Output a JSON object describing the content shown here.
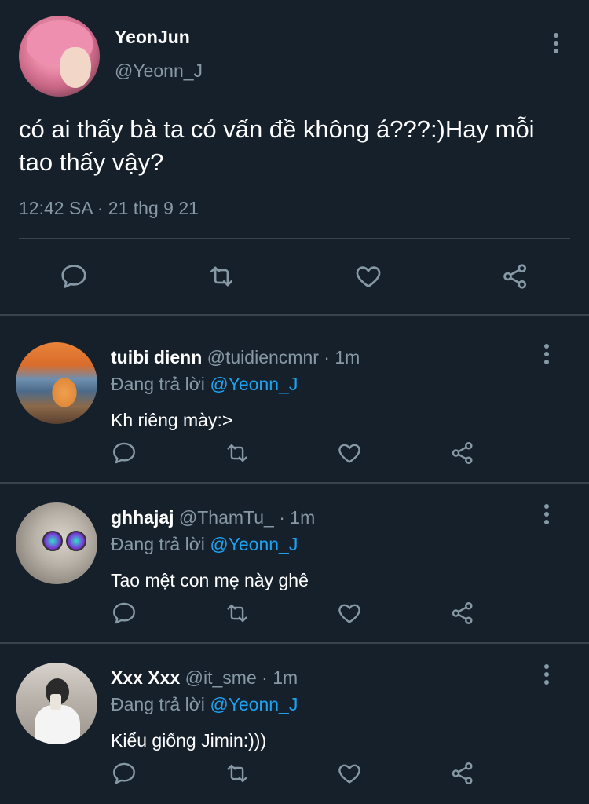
{
  "main_tweet": {
    "name": "YeonJun",
    "handle": "@Yeonn_J",
    "text": "có ai thấy bà ta có vấn đề không á???:)Hay mỗi tao thấy vậy?",
    "timestamp": "12:42 SA · 21 thg 9 21"
  },
  "icons": {
    "reply": "comment-icon",
    "retweet": "retweet-icon",
    "like": "heart-icon",
    "share": "share-icon",
    "more": "more-vertical-icon"
  },
  "colors": {
    "background": "#15202b",
    "secondary_text": "#8899a6",
    "mention": "#1da1f2",
    "divider": "#38444d"
  },
  "replies": [
    {
      "name": "tuibi dienn",
      "handle": "@tuidiencmnr",
      "dot": "·",
      "time": "1m",
      "replying_prefix": "Đang trả lời",
      "replying_to": "@Yeonn_J",
      "text": "Kh riêng mày:>"
    },
    {
      "name": "ghhajaj",
      "handle": "@ThamTu_",
      "dot": "·",
      "time": "1m",
      "replying_prefix": "Đang trả lời",
      "replying_to": "@Yeonn_J",
      "text": "Tao mệt con mẹ này ghê"
    },
    {
      "name": "Xxx Xxx",
      "handle": "@it_sme",
      "dot": "·",
      "time": "1m",
      "replying_prefix": "Đang trả lời",
      "replying_to": "@Yeonn_J",
      "text": "Kiểu giống Jimin:)))"
    }
  ]
}
